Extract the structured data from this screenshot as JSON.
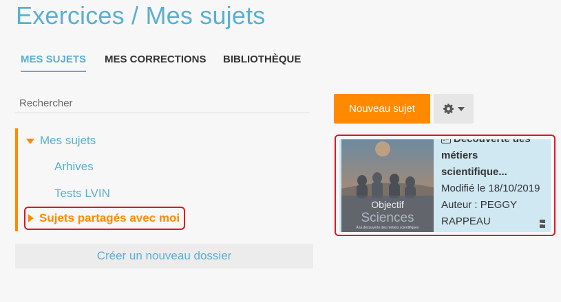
{
  "page": {
    "title": "Exercices / Mes sujets"
  },
  "tabs": [
    {
      "label": "MES SUJETS",
      "active": true
    },
    {
      "label": "MES CORRECTIONS",
      "active": false
    },
    {
      "label": "BIBLIOTHÈQUE",
      "active": false
    }
  ],
  "search": {
    "placeholder": "Rechercher"
  },
  "tree": {
    "root": "Mes sujets",
    "children": [
      "Arhives",
      "Tests LVIN"
    ],
    "shared": "Sujets partagés avec moi"
  },
  "new_folder_label": "Créer un nouveau dossier",
  "toolbar": {
    "new_subject_label": "Nouveau sujet",
    "settings_icon": "gear-icon"
  },
  "card": {
    "title": "Découverte des métiers scientifique...",
    "modified": "Modifié le 18/10/2019",
    "author": "Auteur : PEGGY RAPPEAU",
    "thumbnail_text": {
      "line1": "Objectif",
      "line2": "Sciences",
      "line3": "À la découverte des métiers scientifiques"
    }
  },
  "colors": {
    "accent_blue": "#5aafd0",
    "accent_orange": "#ff8a00",
    "highlight_red": "#e0141e"
  }
}
